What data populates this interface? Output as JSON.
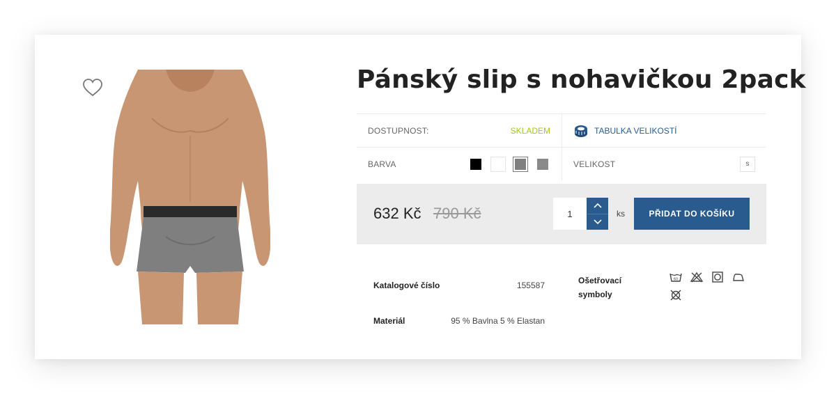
{
  "product": {
    "title": "Pánský slip s nohavičkou 2pack"
  },
  "availability": {
    "label": "DOSTUPNOST:",
    "value": "SKLADEM",
    "value_color": "#a3c623"
  },
  "size_chart": {
    "label": "TABULKA VELIKOSTÍ"
  },
  "color": {
    "label": "BARVA",
    "swatches": [
      {
        "color": "#000000",
        "selected": false
      },
      {
        "color": "#ffffff",
        "selected": false
      },
      {
        "color": "#7f7f7f",
        "selected": true
      },
      {
        "color": "#8a8a8a",
        "selected": false
      }
    ]
  },
  "size": {
    "label": "VELIKOST",
    "value": "s"
  },
  "price": {
    "current": "632 Kč",
    "original": "790 Kč"
  },
  "quantity": {
    "value": "1",
    "unit": "ks"
  },
  "cart": {
    "button_label": "PŘIDAT DO KOŠÍKU",
    "accent": "#2a5b8f"
  },
  "specs": {
    "catalog_label": "Katalogové číslo",
    "catalog_value": "155587",
    "material_label": "Materiál",
    "material_value": "95 % Bavlna 5 % Elastan",
    "care_label": "Ošetřovací symboly",
    "care_icons": [
      "wash-60-icon",
      "no-bleach-icon",
      "tumble-dry-icon",
      "iron-icon",
      "no-dry-clean-icon"
    ]
  }
}
